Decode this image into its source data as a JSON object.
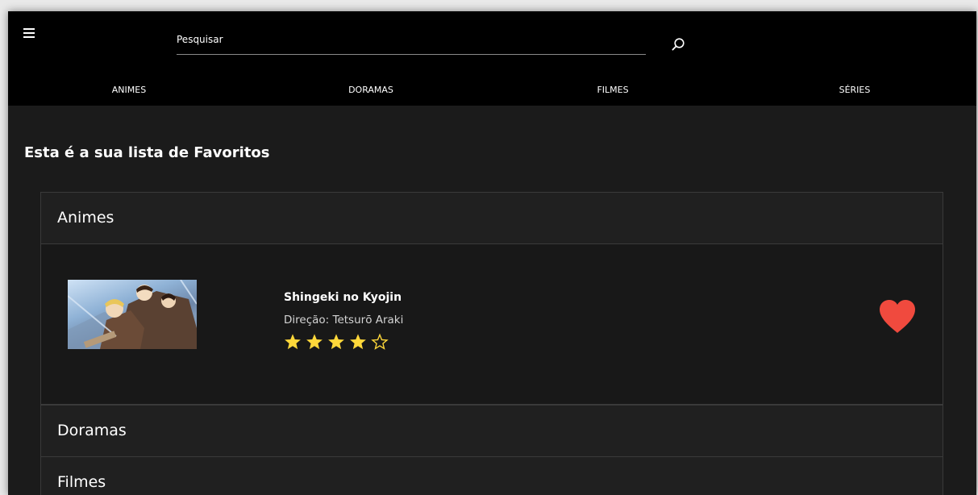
{
  "header": {
    "search_placeholder": "Pesquisar",
    "search_value": "",
    "menu_icon": "hamburger-menu-icon",
    "search_icon": "search-icon"
  },
  "nav": {
    "items": [
      {
        "label": "ANIMES"
      },
      {
        "label": "DORAMAS"
      },
      {
        "label": "FILMES"
      },
      {
        "label": "SÉRIES"
      }
    ]
  },
  "main": {
    "page_title": "Esta é a sua lista de Favoritos",
    "sections": [
      {
        "title": "Animes",
        "expanded": true,
        "items": [
          {
            "title": "Shingeki no Kyojin",
            "director": "Direção: Tetsurō Araki",
            "rating": 4,
            "rating_max": 5,
            "favorited": true
          }
        ]
      },
      {
        "title": "Doramas",
        "expanded": false
      },
      {
        "title": "Filmes",
        "expanded": false
      }
    ]
  },
  "colors": {
    "star": "#ffd83a",
    "heart": "#f04a3e",
    "topbar": "#000000",
    "background": "#1b1b1b"
  }
}
